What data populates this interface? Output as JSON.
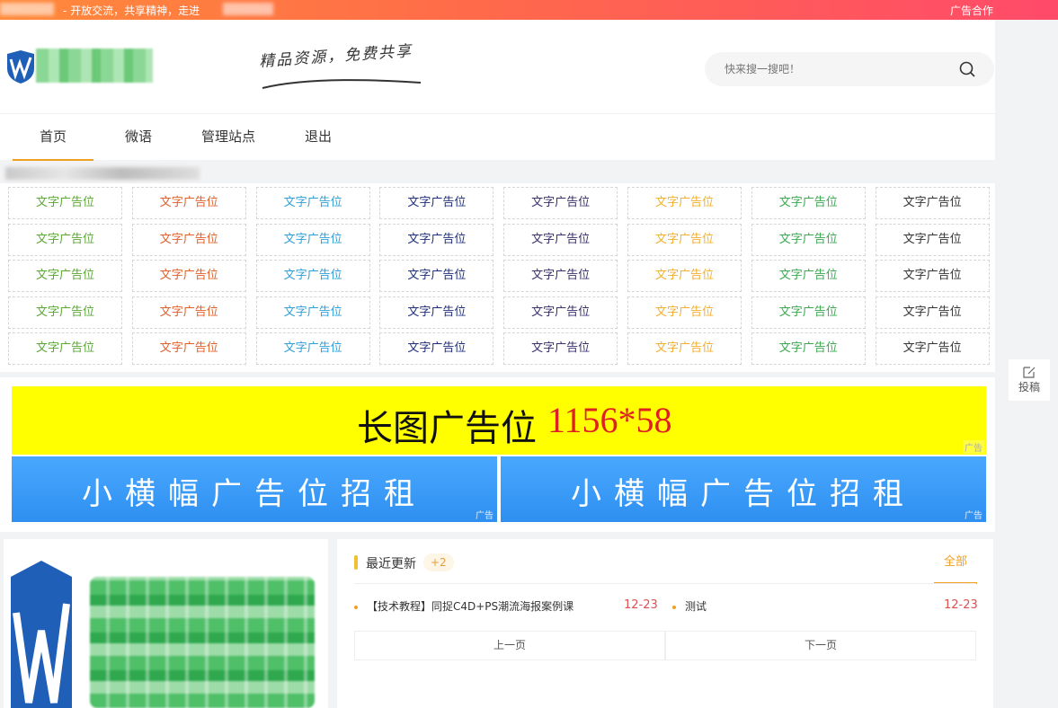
{
  "topbar": {
    "slogan": "- 开放交流，共享精神，走进",
    "ad_coop": "广告合作"
  },
  "header": {
    "tagline": "精品资源，免费共享",
    "search_placeholder": "快来搜一搜吧！"
  },
  "nav": {
    "items": [
      "首页",
      "微语",
      "管理站点",
      "退出"
    ],
    "active": 0
  },
  "text_ads": {
    "label": "文字广告位",
    "column_colors": [
      "#5aa832",
      "#e0602a",
      "#2f9fd8",
      "#1f2f7a",
      "#3a2f6a",
      "#f0b030",
      "#3aa850",
      "#333333"
    ],
    "rows": 5,
    "cols": 8
  },
  "banners": {
    "long_title": "长图广告位",
    "long_size": "1156*58",
    "small_text": "小横幅广告位招租",
    "ad_tag": "广告"
  },
  "recent": {
    "title": "最近更新",
    "count": "+2",
    "all": "全部",
    "posts": [
      {
        "title": "【技术教程】同捉C4D+PS潮流海报案例课",
        "date": "12-23"
      },
      {
        "title": "测试",
        "date": "12-23"
      }
    ],
    "prev": "上一页",
    "next": "下一页"
  },
  "side": {
    "submit_label": "投稿"
  }
}
